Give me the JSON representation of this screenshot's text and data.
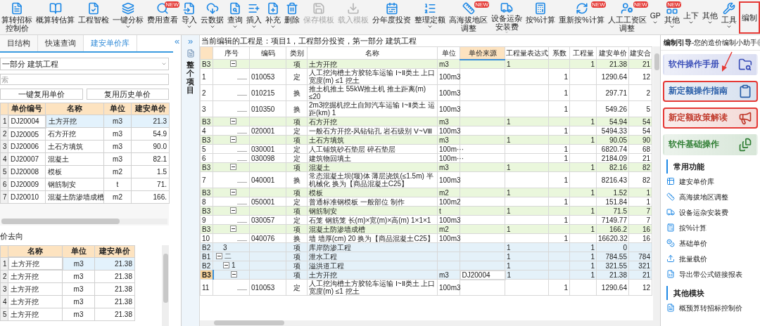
{
  "toolbar": [
    {
      "lines": [
        "算转招标",
        "控制价"
      ],
      "kind": "icon",
      "dropdown": false,
      "disabled": false,
      "highlighted": false
    },
    {
      "lines": [
        "概算转估算"
      ],
      "kind": "icon",
      "dropdown": false,
      "disabled": false,
      "highlighted": false
    },
    {
      "lines": [
        "工程智检"
      ],
      "kind": "icon",
      "dropdown": false,
      "disabled": false,
      "highlighted": false
    },
    {
      "lines": [
        "一键分标"
      ],
      "kind": "icon",
      "dropdown": true,
      "disabled": false,
      "highlighted": false
    },
    {
      "lines": [
        "费用查看"
      ],
      "kind": "icon",
      "badge": "NEW",
      "dropdown": false,
      "disabled": false,
      "highlighted": false
    },
    {
      "lines": [
        "导入"
      ],
      "kind": "icon",
      "dropdown": true,
      "disabled": false,
      "highlighted": false
    },
    {
      "lines": [
        "云数据"
      ],
      "kind": "icon",
      "dropdown": true,
      "disabled": false,
      "highlighted": false
    },
    {
      "lines": [
        "查询"
      ],
      "kind": "icon",
      "dropdown": true,
      "disabled": false,
      "highlighted": false
    },
    {
      "lines": [
        "插入"
      ],
      "kind": "icon",
      "dropdown": true,
      "disabled": false,
      "highlighted": false
    },
    {
      "lines": [
        "补充"
      ],
      "kind": "icon",
      "dropdown": true,
      "disabled": false,
      "highlighted": false
    },
    {
      "lines": [
        "删除"
      ],
      "kind": "icon",
      "dropdown": false,
      "disabled": false,
      "highlighted": false
    },
    {
      "lines": [
        "保存模板"
      ],
      "kind": "icon",
      "dropdown": false,
      "disabled": true,
      "highlighted": false
    },
    {
      "lines": [
        "载入模板"
      ],
      "kind": "icon",
      "dropdown": false,
      "disabled": true,
      "highlighted": false
    },
    {
      "lines": [
        "分年度投资"
      ],
      "kind": "icon",
      "dropdown": false,
      "disabled": false,
      "highlighted": false
    },
    {
      "lines": [
        "整理定额"
      ],
      "kind": "icon",
      "dropdown": true,
      "disabled": false,
      "highlighted": false
    },
    {
      "lines": [
        "高海拔地区",
        "调整"
      ],
      "kind": "icon",
      "badge": "NEW",
      "dropdown": false,
      "disabled": false,
      "highlighted": false
    },
    {
      "lines": [
        "设备运杂",
        "安装费"
      ],
      "kind": "icon",
      "dropdown": true,
      "disabled": false,
      "highlighted": false
    },
    {
      "lines": [
        "按%计算"
      ],
      "kind": "icon",
      "dropdown": false,
      "disabled": false,
      "highlighted": false
    },
    {
      "lines": [
        "重新按%计算"
      ],
      "kind": "icon",
      "badge": "NEW",
      "dropdown": false,
      "disabled": false,
      "highlighted": false
    },
    {
      "lines": [
        "人工工资区",
        "调整"
      ],
      "kind": "icon",
      "badge": "NEW",
      "dropdown": false,
      "disabled": false,
      "highlighted": false
    },
    {
      "lines": [
        "GP"
      ],
      "kind": "text",
      "dropdown": true,
      "disabled": false,
      "highlighted": false
    },
    {
      "lines": [
        "其他"
      ],
      "kind": "icon",
      "badge": "NEW",
      "dropdown": true,
      "disabled": false,
      "highlighted": false
    },
    {
      "lines": [
        "上下"
      ],
      "kind": "text",
      "dropdown": true,
      "disabled": false,
      "highlighted": false
    },
    {
      "lines": [
        "其他"
      ],
      "kind": "text",
      "dropdown": true,
      "disabled": false,
      "highlighted": false
    },
    {
      "lines": [
        "工具"
      ],
      "kind": "icon",
      "dropdown": true,
      "disabled": false,
      "highlighted": false
    },
    {
      "lines": [
        "编制"
      ],
      "kind": "text",
      "dropdown": false,
      "disabled": false,
      "highlighted": true
    }
  ],
  "left_panel": {
    "tabs": [
      {
        "label": "目结构",
        "selected": false
      },
      {
        "label": "快速查询",
        "selected": false
      },
      {
        "label": "建安单价库",
        "selected": true
      }
    ],
    "collapse": "«",
    "category": "一部分  建筑工程",
    "search": {
      "placeholder": "索"
    },
    "buttons": [
      "一键复用单价",
      "复用历史单价"
    ],
    "price_table": {
      "columns": [
        "单价编号",
        "名称",
        "单位",
        "建安单价"
      ],
      "rows": [
        {
          "no": "1",
          "code": "DJ20004",
          "name": "土方开挖",
          "unit": "m3",
          "price": "21.3",
          "selected": true
        },
        {
          "no": "2",
          "code": "DJ20005",
          "name": "石方开挖",
          "unit": "m3",
          "price": "54.9",
          "selected": false
        },
        {
          "no": "3",
          "code": "DJ20006",
          "name": "土石方填筑",
          "unit": "m3",
          "price": "90.0",
          "selected": false
        },
        {
          "no": "4",
          "code": "DJ20007",
          "name": "混凝土",
          "unit": "m3",
          "price": "82.1",
          "selected": false
        },
        {
          "no": "5",
          "code": "DJ20008",
          "name": "模板",
          "unit": "m2",
          "price": "1.5",
          "selected": false
        },
        {
          "no": "6",
          "code": "DJ20009",
          "name": "钢筋制安",
          "unit": "t",
          "price": "71.",
          "selected": false
        },
        {
          "no": "7",
          "code": "DJ20010",
          "name": "混凝土防渗墙成槽",
          "unit": "m2",
          "price": "166.",
          "selected": false
        }
      ]
    },
    "usage_title": "价去向",
    "usage_table": {
      "columns": [
        "名称",
        "单位",
        "建安单价"
      ],
      "rows": [
        {
          "no": "1",
          "name": "土方开挖",
          "unit": "m3",
          "price": "21.38",
          "selected": true
        },
        {
          "no": "2",
          "name": "土方开挖",
          "unit": "m3",
          "price": "21.38",
          "selected": false
        },
        {
          "no": "3",
          "name": "土方开挖",
          "unit": "m3",
          "price": "21.38",
          "selected": false
        },
        {
          "no": "4",
          "name": "土方开挖",
          "unit": "m3",
          "price": "21.38",
          "selected": false
        },
        {
          "no": "5",
          "name": "土方开挖",
          "unit": "m3",
          "price": "21.38",
          "selected": false
        }
      ]
    }
  },
  "strip": {
    "expand": "»",
    "label": "整个项目"
  },
  "current_project": "当前编辑的工程是：项目1，工程部分投资，第一部分 建筑工程",
  "table": {
    "columns": [
      {
        "label": "序号",
        "selected": false
      },
      {
        "label": "编码",
        "selected": false
      },
      {
        "label": "类别",
        "selected": false
      },
      {
        "label": "名称",
        "selected": false
      },
      {
        "label": "单位",
        "selected": false
      },
      {
        "label": "单价来源",
        "selected": true
      },
      {
        "label": "工程量表达式",
        "selected": false
      },
      {
        "label": "系数",
        "selected": false
      },
      {
        "label": "工程量",
        "selected": false
      },
      {
        "label": "建安单价",
        "selected": false
      },
      {
        "label": "建安合",
        "selected": false
      }
    ],
    "rows": [
      {
        "kind": "item",
        "row": "B3",
        "expanded": true,
        "type": "项",
        "name": "土方开挖",
        "unit": "m3",
        "expr": "1",
        "qty": "1",
        "price": "21.38",
        "total": "21",
        "selected": false
      },
      {
        "kind": "quota",
        "row": "1",
        "code": "010053",
        "type": "定",
        "name": "人工挖沟槽土方胶轮车运输 Ⅰ~Ⅱ类土 上口宽度(m) ≤1 挖土",
        "unit": "100m3",
        "coef": "1",
        "price": "1290.64",
        "total": "12",
        "selected": false
      },
      {
        "kind": "quota",
        "row": "2",
        "code": "010215",
        "type": "换",
        "name": "推土机推土 55kW推土机 推土距离(m) ≤20",
        "unit": "100m3",
        "coef": "1",
        "price": "297.71",
        "total": "2",
        "selected": false
      },
      {
        "kind": "quota",
        "row": "3",
        "code": "010350",
        "type": "换",
        "name": "2m3挖掘机挖土自卸汽车运输 Ⅰ~Ⅱ类土 运距(km) 1",
        "unit": "100m3",
        "coef": "1",
        "price": "549.26",
        "total": "5",
        "selected": false
      },
      {
        "kind": "item",
        "row": "B3",
        "expanded": true,
        "type": "项",
        "name": "石方开挖",
        "unit": "m3",
        "expr": "1",
        "qty": "1",
        "price": "54.94",
        "total": "54",
        "selected": false
      },
      {
        "kind": "quota",
        "row": "4",
        "code": "020001",
        "type": "定",
        "name": "一般石方开挖-风钻钻孔 岩石级别 Ⅴ~Ⅷ",
        "unit": "100m3",
        "coef": "1",
        "price": "5494.33",
        "total": "54",
        "selected": false
      },
      {
        "kind": "item",
        "row": "B3",
        "expanded": true,
        "type": "项",
        "name": "土石方填筑",
        "unit": "m3",
        "expr": "1",
        "qty": "1",
        "price": "90.05",
        "total": "90",
        "selected": false
      },
      {
        "kind": "quota",
        "row": "5",
        "code": "030001",
        "type": "定",
        "name": "人工铺筑砂石垫层 碎石垫层",
        "unit": "100m···",
        "coef": "1",
        "price": "6820.74",
        "total": "68",
        "selected": false
      },
      {
        "kind": "quota",
        "row": "6",
        "code": "030098",
        "type": "定",
        "name": "建筑物回填土",
        "unit": "100m···",
        "coef": "1",
        "price": "2184.09",
        "total": "21",
        "selected": false
      },
      {
        "kind": "item",
        "row": "B3",
        "expanded": true,
        "type": "项",
        "name": "混凝土",
        "unit": "m3",
        "expr": "1",
        "qty": "1",
        "price": "82.16",
        "total": "82",
        "selected": false
      },
      {
        "kind": "quota",
        "row": "7",
        "code": "040001",
        "type": "换",
        "name": "常态混凝土坝(堰)体 薄层浇筑(≤1.5m) 半机械化  换为【商品混凝土C25】",
        "unit": "100m3",
        "coef": "1",
        "price": "8216.43",
        "total": "82",
        "selected": false
      },
      {
        "kind": "item",
        "row": "B3",
        "expanded": true,
        "type": "项",
        "name": "模板",
        "unit": "m2",
        "expr": "1",
        "qty": "1",
        "price": "1.52",
        "total": "1",
        "selected": false
      },
      {
        "kind": "quota",
        "row": "8",
        "code": "050001",
        "type": "定",
        "name": "普通标准钢模板 一般部位 制作",
        "unit": "100m2",
        "coef": "1",
        "price": "151.84",
        "total": "1",
        "selected": false
      },
      {
        "kind": "item",
        "row": "B3",
        "expanded": true,
        "type": "项",
        "name": "钢筋制安",
        "unit": "t",
        "expr": "1",
        "qty": "1",
        "price": "71.5",
        "total": "7",
        "selected": false
      },
      {
        "kind": "quota",
        "row": "9",
        "code": "030057",
        "type": "定",
        "name": "石笼 钢筋笼 长(m)×宽(m)×高(m) 1×1×1",
        "unit": "100m3",
        "coef": "1",
        "price": "7149.77",
        "total": "7",
        "selected": false
      },
      {
        "kind": "item",
        "row": "B3",
        "expanded": true,
        "type": "项",
        "name": "混凝土防渗墙成槽",
        "unit": "m2",
        "expr": "1",
        "qty": "1",
        "price": "166.2",
        "total": "16",
        "selected": false
      },
      {
        "kind": "quota",
        "row": "10",
        "code": "040076",
        "type": "换",
        "name": "墙 墙厚(cm) 20  换为【商品混凝土C25】",
        "unit": "100m3",
        "coef": "1",
        "price": "16620.32",
        "total": "16",
        "selected": false
      },
      {
        "kind": "group",
        "row": "B2",
        "seq": "3",
        "type": "项",
        "name": "库岸防渗工程",
        "expr": "1",
        "qty": "1",
        "price": "0",
        "selected": false
      },
      {
        "kind": "part",
        "row": "B1",
        "seq": "二",
        "expanded": true,
        "type": "项",
        "name": "泄水工程",
        "expr": "1",
        "qty": "1",
        "price": "784.55",
        "total": "784",
        "selected": false
      },
      {
        "kind": "group",
        "row": "B2",
        "seq": "1",
        "expanded": true,
        "type": "项",
        "name": "溢洪道工程",
        "expr": "1",
        "qty": "1",
        "price": "321.55",
        "total": "321",
        "selected": false
      },
      {
        "kind": "item",
        "row": "B3",
        "expanded": true,
        "type": "项",
        "name": "土方开挖",
        "unit": "m3",
        "source": "DJ20004",
        "expr": "1",
        "qty": "1",
        "price": "21.38",
        "total": "21",
        "selected": true
      },
      {
        "kind": "quota",
        "row": "11",
        "code": "010053",
        "type": "定",
        "name": "人工挖沟槽土方胶轮车运输 Ⅰ~Ⅱ类土 上口宽度(m) ≤1 挖土",
        "unit": "100m3",
        "coef": "1",
        "price": "1290.64",
        "total": "12",
        "selected": false
      }
    ]
  },
  "guide": {
    "title": "编制引导",
    "subtitle": "-您的造价编制小助手",
    "cards": [
      {
        "label": "软件操作手册",
        "color": "#3b4fb8",
        "highlighted": false
      },
      {
        "label": "新定额操作指南",
        "color": "#2a5ea8",
        "highlighted": true
      },
      {
        "label": "新定额政策解读",
        "color": "#c0392b",
        "highlighted": true
      },
      {
        "label": "软件基础操作",
        "color": "#2e7d32",
        "highlighted": false
      }
    ],
    "sections": [
      {
        "title": "常用功能",
        "items": [
          "建安单价库",
          "高海拔地区调整",
          "设备运杂安装费",
          "按%计算",
          "基础单价",
          "批量载价",
          "导出带公式链接报表"
        ]
      },
      {
        "title": "其他模块",
        "items": [
          "概预算转招标控制价"
        ]
      }
    ]
  }
}
